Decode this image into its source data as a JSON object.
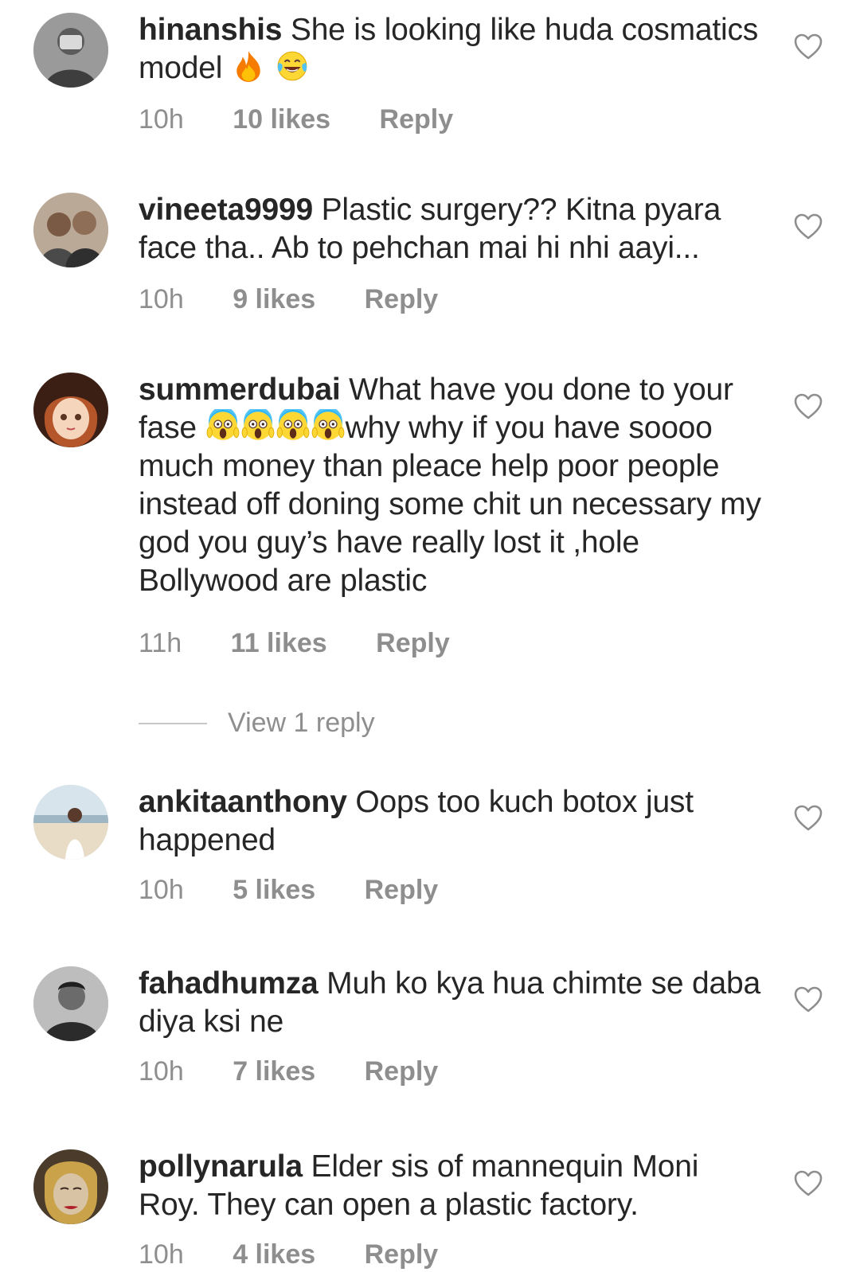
{
  "comments": [
    {
      "username": "hinanshis",
      "text": "She is looking like huda cosmatics model",
      "emojis": [
        "fire-emoji",
        "tears-of-joy-emoji"
      ],
      "time": "10h",
      "likes": "10 likes",
      "reply_label": "Reply"
    },
    {
      "username": "vineeta9999",
      "text": "Plastic surgery?? Kitna pyara face tha.. Ab to pehchan mai hi nhi aayi...",
      "time": "10h",
      "likes": "9 likes",
      "reply_label": "Reply"
    },
    {
      "username": "summerdubai",
      "text_before_emoji": "What have you done to your fase",
      "emojis": [
        "screaming-face-emoji",
        "screaming-face-emoji",
        "screaming-face-emoji",
        "screaming-face-emoji"
      ],
      "text_after_emoji": "why why if you have soooo much money than pleace help poor people instead off doning some chit un necessary my god you guy’s have really lost it ,hole Bollywood are plastic",
      "time": "11h",
      "likes": "11 likes",
      "reply_label": "Reply",
      "view_replies": "View 1 reply"
    },
    {
      "username": "ankitaanthony",
      "text": "Oops too kuch botox just happened",
      "time": "10h",
      "likes": "5 likes",
      "reply_label": "Reply"
    },
    {
      "username": "fahadhumza",
      "text": "Muh ko kya hua chimte se daba diya ksi ne",
      "time": "10h",
      "likes": "7 likes",
      "reply_label": "Reply"
    },
    {
      "username": "pollynarula",
      "text": "Elder sis of mannequin Moni Roy. They can open a plastic factory.",
      "time": "10h",
      "likes": "4 likes",
      "reply_label": "Reply"
    }
  ],
  "icons": {
    "like": "heart-outline-icon"
  },
  "colors": {
    "text": "#262626",
    "muted": "#8e8e8e",
    "heart": "#8e8e8e",
    "divider": "#c7c7c7"
  }
}
